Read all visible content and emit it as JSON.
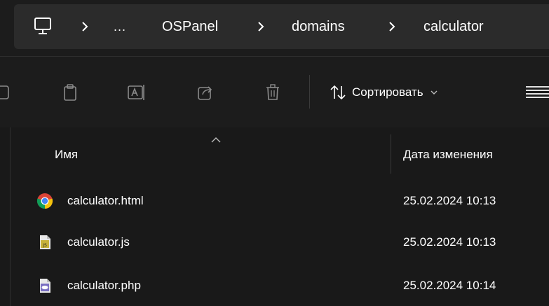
{
  "breadcrumb": {
    "overflow": "...",
    "items": [
      "OSPanel",
      "domains",
      "calculator"
    ]
  },
  "toolbar": {
    "sort_label": "Сортировать",
    "icons": [
      "cut-icon",
      "copy-icon",
      "rename-icon",
      "share-icon",
      "delete-icon",
      "sort-icon",
      "view-icon"
    ]
  },
  "columns": {
    "name": "Имя",
    "date_modified": "Дата изменения"
  },
  "files": [
    {
      "name": "calculator.html",
      "date": "25.02.2024 10:13",
      "icon": "chrome-icon"
    },
    {
      "name": "calculator.js",
      "date": "25.02.2024 10:13",
      "icon": "js-file-icon"
    },
    {
      "name": "calculator.php",
      "date": "25.02.2024 10:14",
      "icon": "php-file-icon"
    }
  ],
  "colors": {
    "background": "#191919",
    "address_bar": "#2b2b2b",
    "text": "#ffffff",
    "icon_gray": "#8a8a8a"
  }
}
